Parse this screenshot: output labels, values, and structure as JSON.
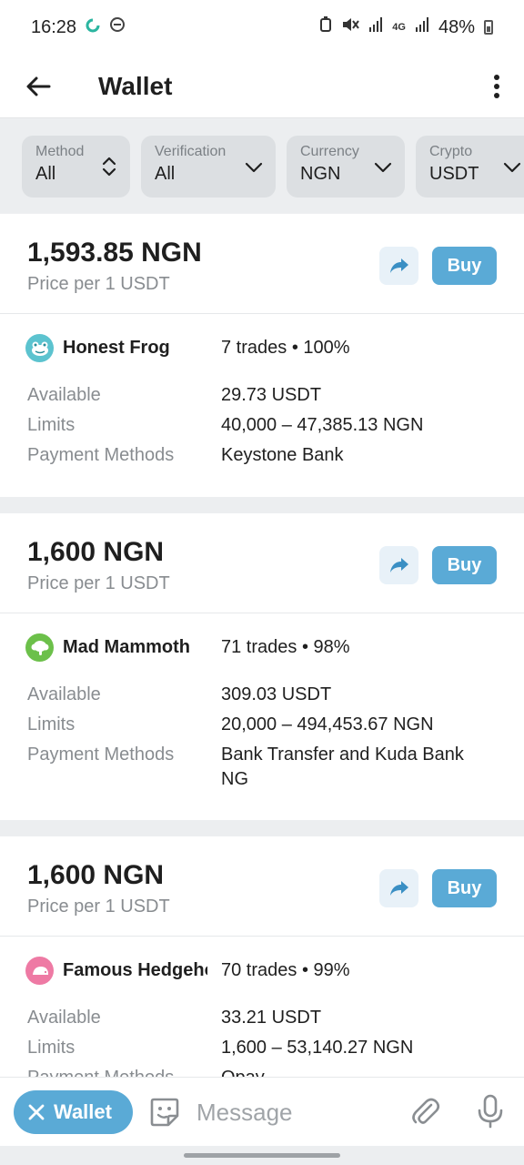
{
  "status_bar": {
    "time": "16:28",
    "network": "4G",
    "battery": "48%"
  },
  "header": {
    "title": "Wallet",
    "back_icon": "arrow-left-icon",
    "more_icon": "more-vertical-icon"
  },
  "filters": [
    {
      "label": "Method",
      "value": "All"
    },
    {
      "label": "Verification",
      "value": "All"
    },
    {
      "label": "Currency",
      "value": "NGN"
    },
    {
      "label": "Crypto",
      "value": "USDT"
    }
  ],
  "offers": [
    {
      "price": "1,593.85 NGN",
      "price_caption": "Price per 1 USDT",
      "buy_label": "Buy",
      "seller": "Honest Frog",
      "avatar_color": "#5cc3cf",
      "trades": "7 trades • 100%",
      "available_label": "Available",
      "available": "29.73 USDT",
      "limits_label": "Limits",
      "limits": "40,000 – 47,385.13 NGN",
      "payment_label": "Payment Methods",
      "payment": "Keystone Bank"
    },
    {
      "price": "1,600 NGN",
      "price_caption": "Price per 1 USDT",
      "buy_label": "Buy",
      "seller": "Mad Mammoth",
      "avatar_color": "#6cc04a",
      "trades": "71 trades • 98%",
      "available_label": "Available",
      "available": "309.03 USDT",
      "limits_label": "Limits",
      "limits": "20,000 – 494,453.67 NGN",
      "payment_label": "Payment Methods",
      "payment": "Bank Transfer and Kuda Bank NG"
    },
    {
      "price": "1,600 NGN",
      "price_caption": "Price per 1 USDT",
      "buy_label": "Buy",
      "seller": "Famous Hedgehog",
      "avatar_color": "#ee7aa4",
      "trades": "70 trades • 99%",
      "available_label": "Available",
      "available": "33.21 USDT",
      "limits_label": "Limits",
      "limits": "1,600 – 53,140.27 NGN",
      "payment_label": "Payment Methods",
      "payment": "Opay"
    }
  ],
  "composer": {
    "chip_label": "Wallet",
    "placeholder": "Message"
  },
  "colors": {
    "accent": "#5aaad6",
    "share_bg": "#e8f1f8"
  }
}
